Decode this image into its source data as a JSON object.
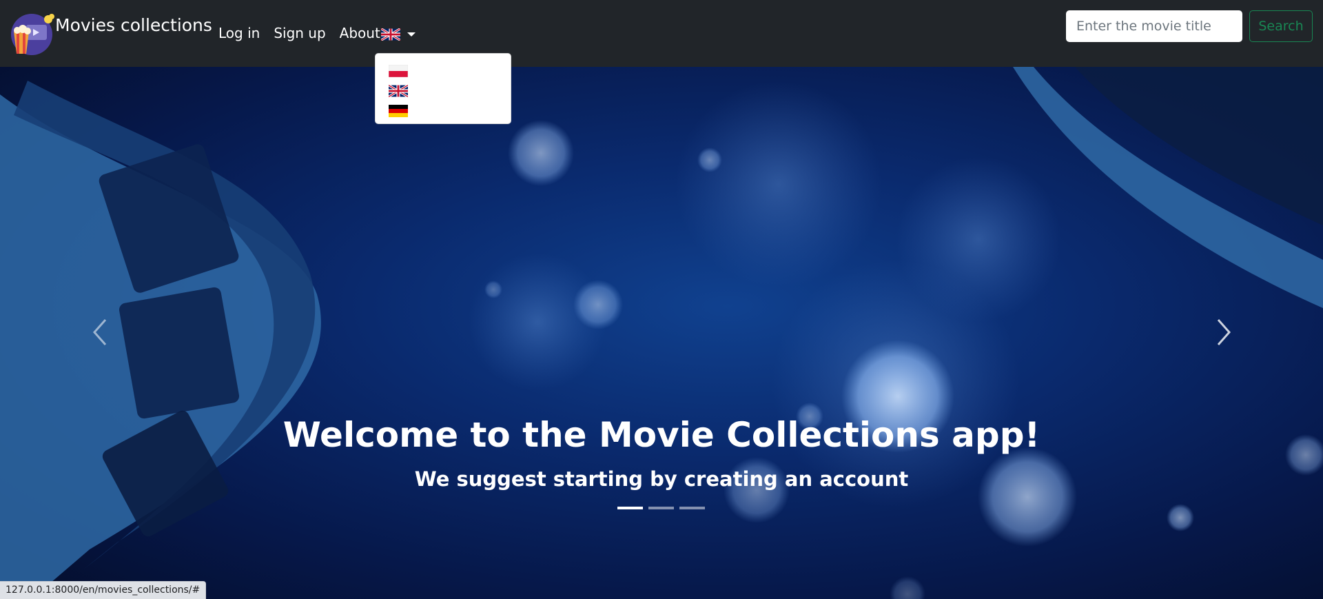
{
  "navbar": {
    "brand_text": "Movies collections",
    "links": [
      "Log in",
      "Sign up",
      "About"
    ],
    "current_language_icon": "uk-flag-icon",
    "search": {
      "placeholder": "Enter the movie title",
      "button_label": "Search"
    }
  },
  "language_menu": {
    "items": [
      {
        "icon": "poland-flag-icon"
      },
      {
        "icon": "uk-flag-icon"
      },
      {
        "icon": "germany-flag-icon"
      }
    ]
  },
  "hero": {
    "title": "Welcome to the Movie Collections app!",
    "subtitle": "We suggest starting by creating an account",
    "slides_count": 3,
    "active_slide": 1
  },
  "status_bar": {
    "url": "127.0.0.1:8000/en/movies_collections/#"
  },
  "colors": {
    "navbar_bg": "#212529",
    "search_accent": "#198754",
    "hero_blue": "#0a2a6e"
  }
}
